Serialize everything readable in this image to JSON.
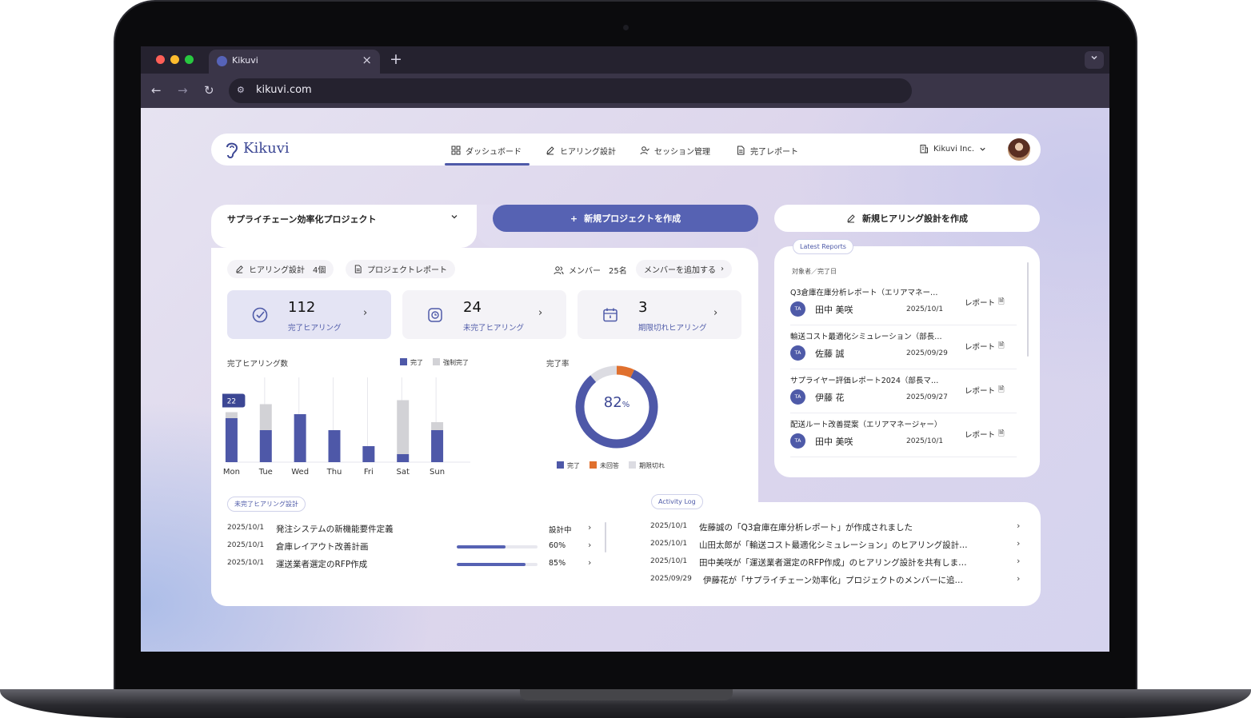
{
  "browser": {
    "tab_title": "Kikuvi",
    "tab_close": "×",
    "new_tab": "+",
    "url": "kikuvi.com",
    "menu_chevron": "⌄"
  },
  "nav": {
    "logo": "Kikuvi",
    "items": [
      {
        "label": "ダッシュボード",
        "icon": "grid-icon"
      },
      {
        "label": "ヒアリング設計",
        "icon": "pencil-icon"
      },
      {
        "label": "セッション管理",
        "icon": "user-check-icon"
      },
      {
        "label": "完了レポート",
        "icon": "document-icon"
      }
    ],
    "org": "Kikuvi Inc."
  },
  "project": {
    "name": "サプライチェーン効率化プロジェクト",
    "design_pill": "ヒアリング設計　4個",
    "report_pill": "プロジェクトレポート",
    "members": "メンバー　25名",
    "add_member": "メンバーを追加する"
  },
  "actions": {
    "new_project": "新規プロジェクトを作成",
    "new_hearing": "新規ヒアリング設計を作成"
  },
  "stats": [
    {
      "value": "112",
      "label": "完了ヒアリング",
      "icon": "check-circle-icon"
    },
    {
      "value": "24",
      "label": "未完了ヒアリング",
      "icon": "pending-clock-icon"
    },
    {
      "value": "3",
      "label": "期限切れヒアリング",
      "icon": "calendar-icon"
    }
  ],
  "bar_chart": {
    "title": "完了ヒアリング数",
    "legend": [
      "完了",
      "強制完了"
    ],
    "tooltip": "22"
  },
  "donut": {
    "title": "完了率",
    "center": "82",
    "unit": "%",
    "legend": [
      "完了",
      "未回答",
      "期限切れ"
    ]
  },
  "chart_data": [
    {
      "type": "bar",
      "title": "完了ヒアリング数",
      "categories": [
        "Mon",
        "Tue",
        "Wed",
        "Thu",
        "Fri",
        "Sat",
        "Sun"
      ],
      "series": [
        {
          "name": "完了",
          "values": [
            22,
            16,
            24,
            16,
            8,
            4,
            16
          ]
        },
        {
          "name": "強制完了",
          "values": [
            3,
            13,
            0,
            0,
            0,
            27,
            4
          ]
        }
      ],
      "ylim": [
        0,
        40
      ],
      "grid": true,
      "legend_position": "top-right",
      "colors": [
        "#4e58a8",
        "#d2d2d6"
      ]
    },
    {
      "type": "pie",
      "title": "完了率",
      "labels": [
        "完了",
        "未回答",
        "期限切れ"
      ],
      "values": [
        82,
        7,
        11
      ],
      "colors": [
        "#4e58a8",
        "#e0702e",
        "#dcdce2"
      ]
    }
  ],
  "incomplete": {
    "section": "未完了ヒアリング設計",
    "rows": [
      {
        "date": "2025/10/1",
        "title": "発注システムの新機能要件定義",
        "status": "設計中",
        "progress": null
      },
      {
        "date": "2025/10/1",
        "title": "倉庫レイアウト改善計画",
        "status": "60%",
        "progress": 0.6
      },
      {
        "date": "2025/10/1",
        "title": "運送業者選定のRFP作成",
        "status": "85%",
        "progress": 0.85
      }
    ]
  },
  "reports": {
    "section": "Latest Reports",
    "header": "対象者／完了日",
    "link": "レポート",
    "items": [
      {
        "title": "Q3倉庫在庫分析レポート（エリアマネー…",
        "initials": "TA",
        "name": "田中 美咲",
        "date": "2025/10/1"
      },
      {
        "title": "輸送コスト最適化シミュレーション（部長…",
        "initials": "TA",
        "name": "佐藤 誠",
        "date": "2025/09/29"
      },
      {
        "title": "サプライヤー評価レポート2024（部長マ…",
        "initials": "TA",
        "name": "伊藤 花",
        "date": "2025/09/27"
      },
      {
        "title": "配送ルート改善提案（エリアマネージャー）",
        "initials": "TA",
        "name": "田中 美咲",
        "date": "2025/10/1"
      }
    ]
  },
  "activity": {
    "section": "Activity Log",
    "rows": [
      {
        "date": "2025/10/1",
        "text": "佐藤誠の「Q3倉庫在庫分析レポート」が作成されました"
      },
      {
        "date": "2025/10/1",
        "text": "山田太郎が「輸送コスト最適化シミュレーション」のヒアリング設計…"
      },
      {
        "date": "2025/10/1",
        "text": "田中美咲が「運送業者選定のRFP作成」のヒアリング設計を共有しま…"
      },
      {
        "date": "2025/09/29",
        "text": "伊藤花が「サプライチェーン効率化」プロジェクトのメンバーに追…"
      }
    ]
  }
}
